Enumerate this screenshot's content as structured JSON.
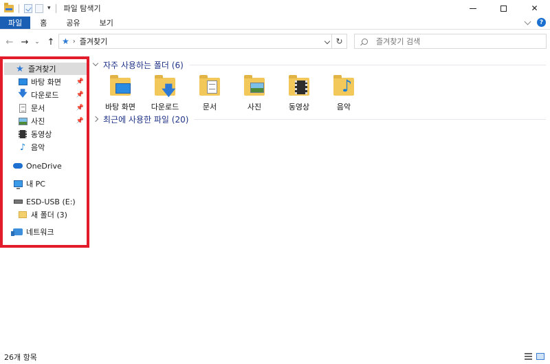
{
  "window": {
    "title": "파일 탐색기"
  },
  "ribbon": {
    "tabs": [
      "파일",
      "홈",
      "공유",
      "보기"
    ]
  },
  "address": {
    "path_label": "즐겨찾기"
  },
  "search": {
    "placeholder": "즐겨찾기 검색"
  },
  "sidebar": {
    "quick_access": "즐겨찾기",
    "pinned": [
      {
        "label": "바탕 화면",
        "icon": "desktop-icon",
        "pinned": true
      },
      {
        "label": "다운로드",
        "icon": "download-icon",
        "pinned": true
      },
      {
        "label": "문서",
        "icon": "document-icon",
        "pinned": true
      },
      {
        "label": "사진",
        "icon": "pictures-icon",
        "pinned": true
      },
      {
        "label": "동영상",
        "icon": "videos-icon",
        "pinned": false
      },
      {
        "label": "음악",
        "icon": "music-icon",
        "pinned": false
      }
    ],
    "onedrive": "OneDrive",
    "this_pc": "내 PC",
    "usb": "ESD-USB (E:)",
    "new_folder": "새 폴더 (3)",
    "network": "네트워크"
  },
  "main": {
    "frequent_header": "자주 사용하는 폴더 (6)",
    "frequent_folders": [
      {
        "label": "바탕 화면",
        "icon": "desktop-folder-icon"
      },
      {
        "label": "다운로드",
        "icon": "downloads-folder-icon"
      },
      {
        "label": "문서",
        "icon": "documents-folder-icon"
      },
      {
        "label": "사진",
        "icon": "pictures-folder-icon"
      },
      {
        "label": "동영상",
        "icon": "videos-folder-icon"
      },
      {
        "label": "음악",
        "icon": "music-folder-icon"
      }
    ],
    "recent_header": "최근에 사용한 파일 (20)"
  },
  "status": {
    "item_count": "26개 항목"
  },
  "colors": {
    "accent": "#1a5fb4",
    "highlight_border": "#e21c2b",
    "group_header": "#1e3287"
  }
}
